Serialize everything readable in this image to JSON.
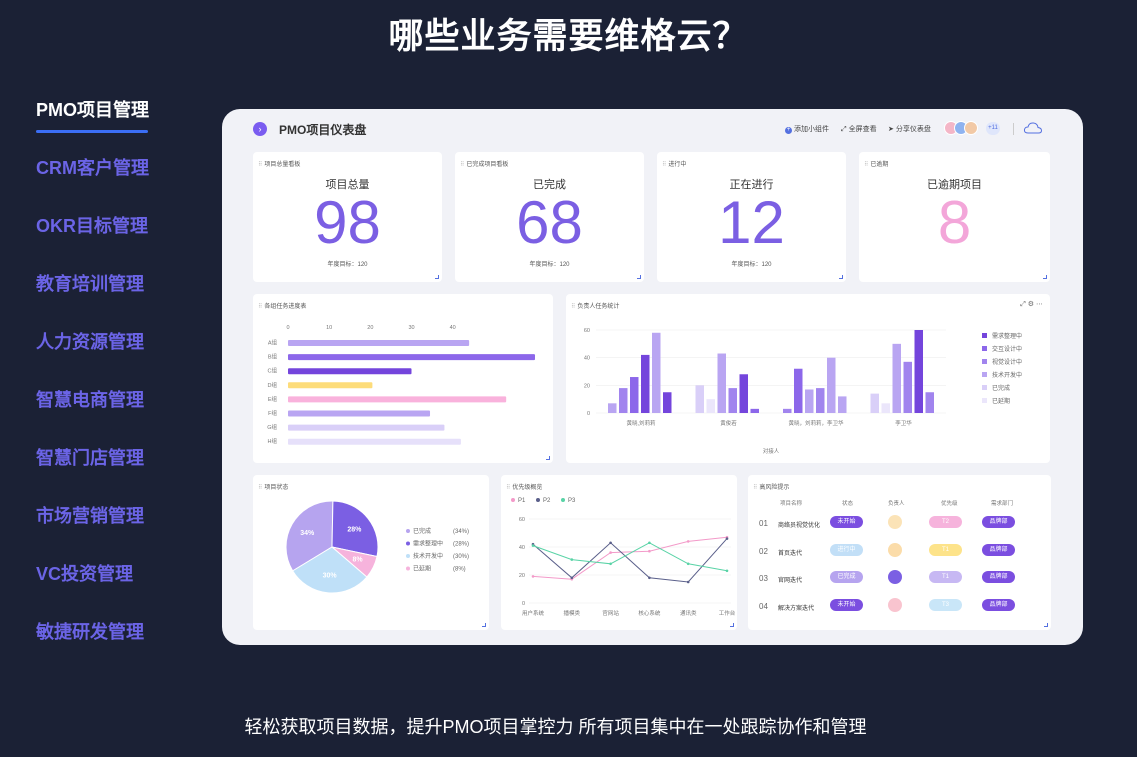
{
  "page": {
    "title": "哪些业务需要维格云？",
    "footer": "轻松获取项目数据，提升PMO项目掌控力 所有项目集中在一处跟踪协作和管理"
  },
  "sidebar": {
    "items": [
      {
        "label": "PMO项目管理"
      },
      {
        "label": "CRM客户管理"
      },
      {
        "label": "OKR目标管理"
      },
      {
        "label": "教育培训管理"
      },
      {
        "label": "人力资源管理"
      },
      {
        "label": "智慧电商管理"
      },
      {
        "label": "智慧门店管理"
      },
      {
        "label": "市场营销管理"
      },
      {
        "label": "VC投资管理"
      },
      {
        "label": "敏捷研发管理"
      }
    ]
  },
  "dashboard": {
    "title": "PMO项目仪表盘",
    "actions": {
      "add": "添加小组件",
      "fullscreen": "全屏查看",
      "share": "分享仪表盘"
    },
    "avatar_more": "+11",
    "stats": [
      {
        "card_title": "项目总量看板",
        "label": "项目总量",
        "value": "98",
        "goal": "年度目标：120",
        "color": "#7b5fe3"
      },
      {
        "card_title": "已完成项目看板",
        "label": "已完成",
        "value": "68",
        "goal": "年度目标：120",
        "color": "#7b5fe3"
      },
      {
        "card_title": "进行中",
        "label": "正在进行",
        "value": "12",
        "goal": "年度目标：120",
        "color": "#7b5fe3"
      },
      {
        "card_title": "已逾期",
        "label": "已逾期项目",
        "value": "8",
        "goal": "",
        "color": "#f3a6d9"
      }
    ],
    "progress_card_title": "各组任务进度表",
    "owner_card_title": "负责人任务统计",
    "status_card_title": "项目状态",
    "priority_card_title": "优先级概览",
    "risk": {
      "card_title": "高风险提示",
      "headers": [
        "项目名称",
        "状态",
        "负责人",
        "优先级",
        "需求部门"
      ],
      "rows": [
        {
          "no": "01",
          "name": "商络员视觉优化",
          "status": "未开始",
          "status_color": "#7b4ee0",
          "priority": "T2",
          "priority_color": "#f6b3dc",
          "dept": "品牌部"
        },
        {
          "no": "02",
          "name": "首页迭代",
          "status": "进行中",
          "status_color": "#c2dff7",
          "priority": "T1",
          "priority_color": "#fde38a",
          "dept": "品牌部"
        },
        {
          "no": "03",
          "name": "官网迭代",
          "status": "已完成",
          "status_color": "#b6a4ef",
          "priority": "T1",
          "priority_color": "#c7b8f3",
          "dept": "品牌部"
        },
        {
          "no": "04",
          "name": "解决方案迭代",
          "status": "未开始",
          "status_color": "#7b4ee0",
          "priority": "T3",
          "priority_color": "#c9e6f8",
          "dept": "品牌部"
        }
      ]
    }
  },
  "chart_data": [
    {
      "type": "bar",
      "orientation": "horizontal",
      "title": "各组任务进度表",
      "categories": [
        "A组",
        "B组",
        "C组",
        "D组",
        "E组",
        "F组",
        "G组",
        "H组"
      ],
      "values": [
        44,
        60,
        30,
        20.5,
        53,
        34.5,
        38,
        42
      ],
      "colors": [
        "#b9a5f2",
        "#8c67ea",
        "#7445dc",
        "#fddc7a",
        "#f9b2dc",
        "#b9a5f2",
        "#d9cff8",
        "#e6e0fa"
      ],
      "xticks": [
        0,
        10,
        20,
        30,
        40
      ],
      "xlim": [
        0,
        60
      ]
    },
    {
      "type": "bar",
      "title": "负责人任务统计",
      "xlabel": "对接人",
      "categories": [
        "黄晓,刘莉莉",
        "黄俊若",
        "黄晓，刘莉莉，李卫华",
        "李卫华"
      ],
      "ylim": [
        0,
        60
      ],
      "yticks": [
        0,
        20,
        40,
        60
      ],
      "series": [
        {
          "name": "需求整理中",
          "color": "#7445dc",
          "values": [
            15,
            0,
            0,
            60
          ]
        },
        {
          "name": "交互设计中",
          "color": "#8c67ea",
          "values": [
            18,
            0,
            0,
            0
          ]
        },
        {
          "name": "视觉设计中",
          "color": "#a184ee",
          "values": [
            26,
            28,
            0,
            0
          ]
        },
        {
          "name": "技术开发中",
          "color": "#b9a5f2",
          "values": [
            42,
            0,
            0,
            0
          ]
        },
        {
          "name": "已完成",
          "color": "#d9cff8",
          "values": [
            58,
            0,
            0,
            0
          ]
        },
        {
          "name": "已延期",
          "color": "#ebe6fb",
          "values": [
            0,
            0,
            0,
            0
          ]
        }
      ],
      "groups": [
        {
          "category": "黄晓,刘莉莉",
          "bars": [
            {
              "s": 3,
              "v": 7
            },
            {
              "s": 2,
              "v": 18
            },
            {
              "s": 1,
              "v": 26
            },
            {
              "s": 0,
              "v": 42
            },
            {
              "s": 3,
              "v": 58
            },
            {
              "s": 0,
              "v": 15
            }
          ]
        },
        {
          "category": "黄俊若",
          "bars": [
            {
              "s": 4,
              "v": 20
            },
            {
              "s": 5,
              "v": 10
            },
            {
              "s": 3,
              "v": 43
            },
            {
              "s": 2,
              "v": 18
            },
            {
              "s": 0,
              "v": 28
            },
            {
              "s": 1,
              "v": 3
            }
          ]
        },
        {
          "category": "黄晓，刘莉莉，李卫华",
          "bars": [
            {
              "s": 2,
              "v": 3
            },
            {
              "s": 1,
              "v": 32
            },
            {
              "s": 3,
              "v": 17
            },
            {
              "s": 2,
              "v": 18
            },
            {
              "s": 3,
              "v": 40
            },
            {
              "s": 3,
              "v": 12
            }
          ]
        },
        {
          "category": "李卫华",
          "bars": [
            {
              "s": 4,
              "v": 14
            },
            {
              "s": 5,
              "v": 7
            },
            {
              "s": 3,
              "v": 50
            },
            {
              "s": 2,
              "v": 37
            },
            {
              "s": 0,
              "v": 60
            },
            {
              "s": 2,
              "v": 15
            }
          ]
        }
      ]
    },
    {
      "type": "pie",
      "title": "项目状态",
      "slices": [
        {
          "label": "已完成",
          "pct_label": "(34%)",
          "value": 34,
          "color": "#b6a4ef"
        },
        {
          "label": "需求整理中",
          "pct_label": "(28%)",
          "value": 28,
          "color": "#7b5fe3"
        },
        {
          "label": "技术开发中",
          "pct_label": "(30%)",
          "value": 30,
          "color": "#bfe0f8"
        },
        {
          "label": "已延期",
          "pct_label": "(8%)",
          "value": 8,
          "color": "#f6b3dc"
        }
      ],
      "inner_labels": [
        "34%",
        "28%",
        "8%",
        "30%"
      ]
    },
    {
      "type": "line",
      "title": "优先级概览",
      "categories": [
        "用户系统",
        "播模类",
        "官网站",
        "核心系统",
        "通讯类",
        "工作台"
      ],
      "ylim": [
        0,
        60
      ],
      "yticks": [
        0,
        20,
        40,
        60
      ],
      "series": [
        {
          "name": "P1",
          "color": "#f39ac9",
          "values": [
            19,
            17,
            36,
            37,
            44,
            47
          ]
        },
        {
          "name": "P2",
          "color": "#5a5f8a",
          "values": [
            42,
            18,
            43,
            18,
            15,
            46
          ]
        },
        {
          "name": "P3",
          "color": "#59d3a6",
          "values": [
            41,
            31,
            28,
            43,
            28,
            23
          ]
        }
      ]
    }
  ]
}
